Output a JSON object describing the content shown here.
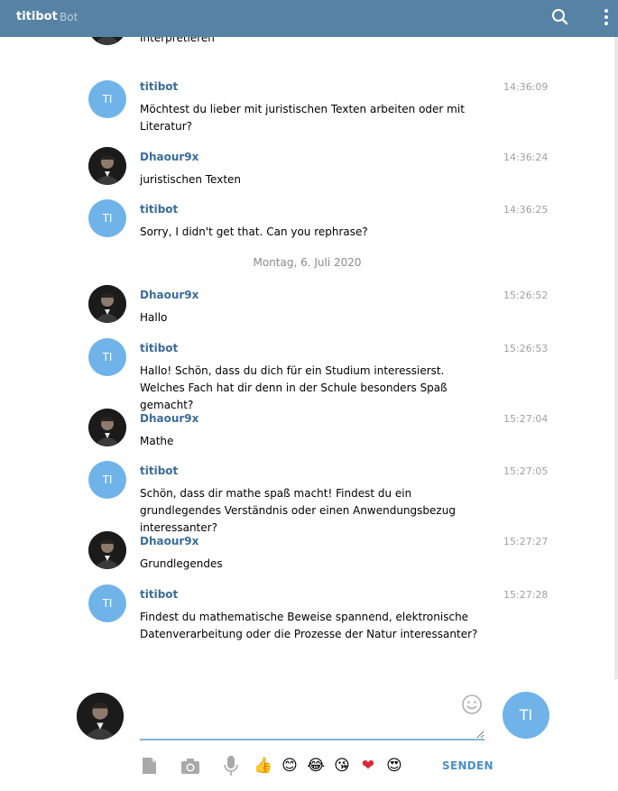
{
  "header": {
    "title": "titibot",
    "subtitle": "Bot"
  },
  "bot_avatar_initials": "TI",
  "messages": [
    {
      "kind": "user",
      "author": "",
      "time": "",
      "text": "Interpretieren"
    },
    {
      "kind": "bot",
      "author": "titibot",
      "time": "14:36:09",
      "text": "Möchtest du lieber mit juristischen Texten arbeiten oder mit Literatur?"
    },
    {
      "kind": "user",
      "author": "Dhaour9x",
      "time": "14:36:24",
      "text": "juristischen Texten"
    },
    {
      "kind": "bot",
      "author": "titibot",
      "time": "14:36:25",
      "text": "Sorry, I didn't get that. Can you rephrase?"
    },
    {
      "kind": "user",
      "author": "Dhaour9x",
      "time": "15:26:52",
      "text": "Hallo"
    },
    {
      "kind": "bot",
      "author": "titibot",
      "time": "15:26:53",
      "text": "Hallo! Schön, dass du dich für ein Studium interessierst. Welches Fach hat dir denn in der Schule besonders Spaß gemacht?"
    },
    {
      "kind": "user",
      "author": "Dhaour9x",
      "time": "15:27:04",
      "text": "Mathe"
    },
    {
      "kind": "bot",
      "author": "titibot",
      "time": "15:27:05",
      "text": "Schön, dass dir mathe spaß macht! Findest du ein grundlegendes Verständnis oder einen Anwendungsbezug interessanter?"
    },
    {
      "kind": "user",
      "author": "Dhaour9x",
      "time": "15:27:27",
      "text": "Grundlegendes"
    },
    {
      "kind": "bot",
      "author": "titibot",
      "time": "15:27:28",
      "text": "Findest du mathematische Beweise spannend, elektronische Datenverarbeitung oder die Prozesse der Natur interessanter?"
    }
  ],
  "date_separator": "Montag, 6. Juli 2020",
  "composer": {
    "input_value": "",
    "send_label": "SENDEN",
    "peer_initials": "TI",
    "quick_emojis": [
      "👍",
      "😊",
      "😂",
      "😘",
      "❤",
      "😍"
    ]
  },
  "icons": {
    "search": "search-icon",
    "menu": "more-vertical-icon",
    "attach": "document-icon",
    "camera": "camera-icon",
    "mic": "microphone-icon",
    "emoji": "smiley-icon"
  },
  "colors": {
    "header_bg": "#5682a3",
    "author_name": "#3a6d99",
    "bot_avatar": "#6fb3e8",
    "send": "#4a90c9"
  }
}
